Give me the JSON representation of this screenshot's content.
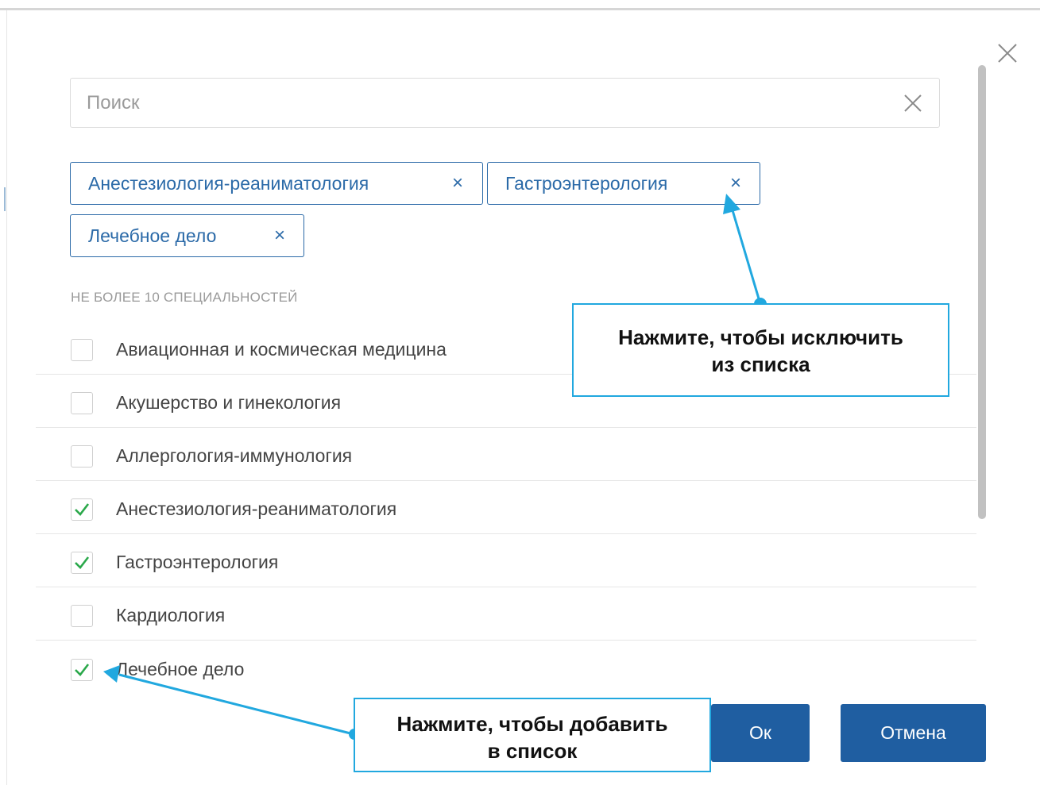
{
  "dialog": {
    "search": {
      "placeholder": "Поиск",
      "value": ""
    },
    "selected_chips": [
      {
        "label": "Анестезиология-реаниматология",
        "remove": "×"
      },
      {
        "label": "Гастроэнтерология",
        "remove": "×"
      },
      {
        "label": "Лечебное дело",
        "remove": "×"
      }
    ],
    "limit_note": "НЕ БОЛЕЕ 10 СПЕЦИАЛЬНОСТЕЙ",
    "items": [
      {
        "label": "Авиационная и космическая медицина",
        "checked": false
      },
      {
        "label": "Акушерство и гинекология",
        "checked": false
      },
      {
        "label": "Аллергология-иммунология",
        "checked": false
      },
      {
        "label": "Анестезиология-реаниматология",
        "checked": true
      },
      {
        "label": "Гастроэнтерология",
        "checked": true
      },
      {
        "label": "Кардиология",
        "checked": false
      },
      {
        "label": "Лечебное дело",
        "checked": true
      }
    ],
    "buttons": {
      "ok": "Ок",
      "cancel": "Отмена"
    }
  },
  "callouts": {
    "exclude": {
      "line1": "Нажмите, чтобы исключить",
      "line2": "из списка"
    },
    "add": {
      "line1": "Нажмите, чтобы добавить",
      "line2": "в список"
    }
  },
  "icons": {
    "close": "close-icon",
    "search_clear": "clear-icon",
    "chip_remove": "remove-icon",
    "check": "check-icon"
  },
  "colors": {
    "accent": "#1f5ea1",
    "chip_border": "#2b6aa8",
    "check": "#2aa84a",
    "callout_border": "#21a8df"
  }
}
